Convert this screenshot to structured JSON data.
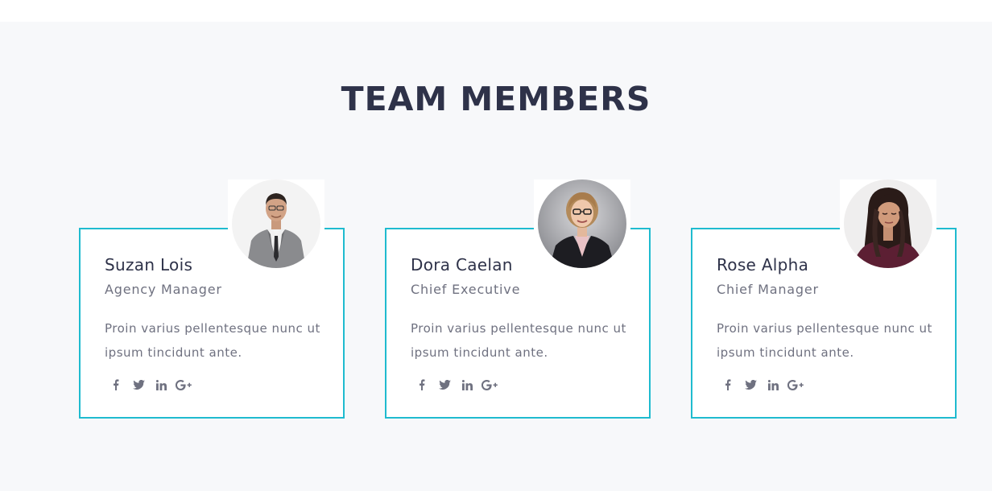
{
  "section": {
    "title": "TEAM MEMBERS"
  },
  "members": [
    {
      "name": "Suzan Lois",
      "role": "Agency Manager",
      "description": "Proin varius pellentesque nunc ut ipsum tincidunt ante.",
      "photo_alt": "man in grey suit"
    },
    {
      "name": "Dora Caelan",
      "role": "Chief Executive",
      "description": "Proin varius pellentesque nunc ut ipsum tincidunt ante.",
      "photo_alt": "woman with glasses in black blazer"
    },
    {
      "name": "Rose Alpha",
      "role": "Chief Manager",
      "description": "Proin varius pellentesque nunc ut ipsum tincidunt ante.",
      "photo_alt": "woman with long dark hair"
    }
  ],
  "social_icons": [
    "facebook-icon",
    "twitter-icon",
    "linkedin-icon",
    "google-plus-icon"
  ],
  "colors": {
    "accent": "#1fbbcf",
    "heading": "#2e3249",
    "text": "#6f7180",
    "background": "#f7f8fa"
  }
}
